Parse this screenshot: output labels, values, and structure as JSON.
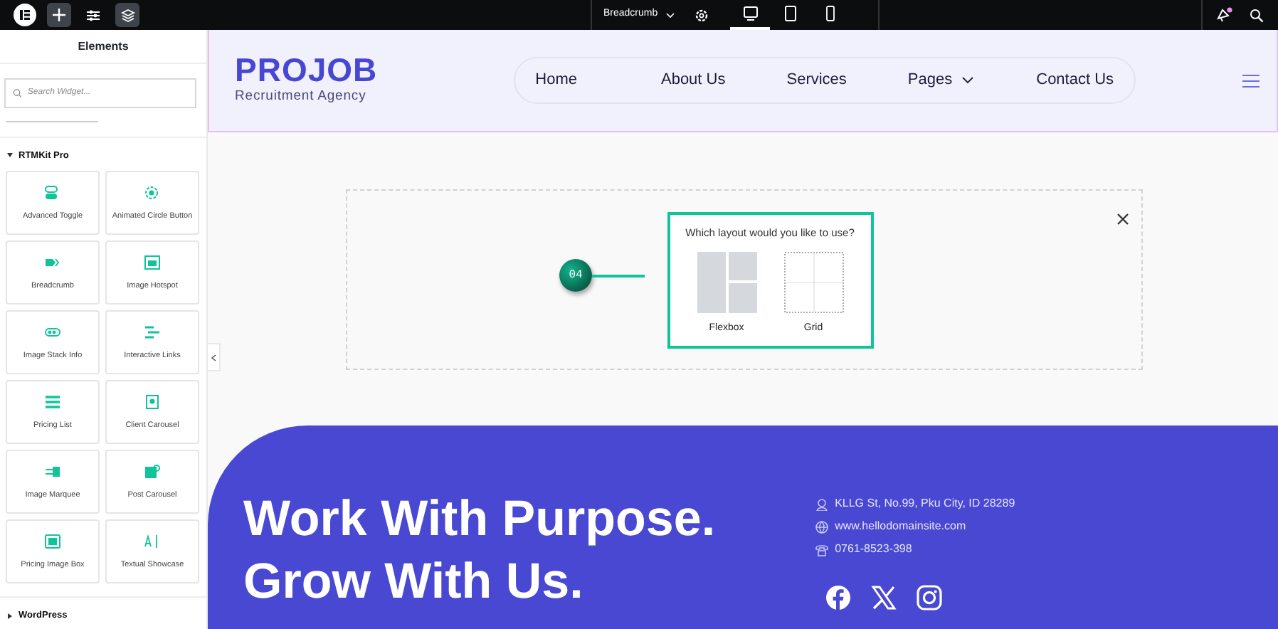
{
  "topbar": {
    "page_title": "Breadcrumb",
    "devices": [
      {
        "selected": true
      },
      {
        "selected": false
      },
      {
        "selected": false
      }
    ],
    "notification_unread": true
  },
  "sidebar": {
    "title": "Elements",
    "search": {
      "placeholder": "Search Widget..."
    },
    "categories": [
      {
        "label": "RTMKit Pro",
        "expanded": true,
        "widgets": [
          {
            "label": "Advanced Toggle"
          },
          {
            "label": "Animated Circle Button"
          },
          {
            "label": "Breadcrumb"
          },
          {
            "label": "Image Hotspot"
          },
          {
            "label": "Image Stack Info"
          },
          {
            "label": "Interactive Links"
          },
          {
            "label": "Pricing List"
          },
          {
            "label": "Client Carousel"
          },
          {
            "label": "Image Marquee"
          },
          {
            "label": "Post Carousel"
          },
          {
            "label": "Pricing Image Box"
          },
          {
            "label": "Textual Showcase"
          }
        ]
      },
      {
        "label": "WordPress",
        "expanded": false
      }
    ]
  },
  "header": {
    "logo": "PROJOB",
    "tagline": "Recruitment Agency",
    "nav": [
      {
        "label": "Home",
        "dropdown": false
      },
      {
        "label": "About Us",
        "dropdown": false
      },
      {
        "label": "Services",
        "dropdown": false
      },
      {
        "label": "Pages",
        "dropdown": true
      },
      {
        "label": "Contact Us",
        "dropdown": false
      }
    ]
  },
  "dropzone": {
    "step": "04",
    "question": "Which layout would you like to use?",
    "options": [
      {
        "label": "Flexbox",
        "kind": "flexbox"
      },
      {
        "label": "Grid",
        "kind": "grid"
      }
    ]
  },
  "footer": {
    "headline": [
      "Work With Purpose.",
      "Grow With Us."
    ],
    "contacts": [
      {
        "kind": "address",
        "text": "KLLG St, No.99, Pku City, ID 28289"
      },
      {
        "kind": "web",
        "text": "www.hellodomainsite.com"
      },
      {
        "kind": "phone",
        "text": "0761-8523-398"
      }
    ],
    "socials": [
      {
        "kind": "facebook"
      },
      {
        "kind": "x"
      },
      {
        "kind": "instagram"
      }
    ]
  }
}
